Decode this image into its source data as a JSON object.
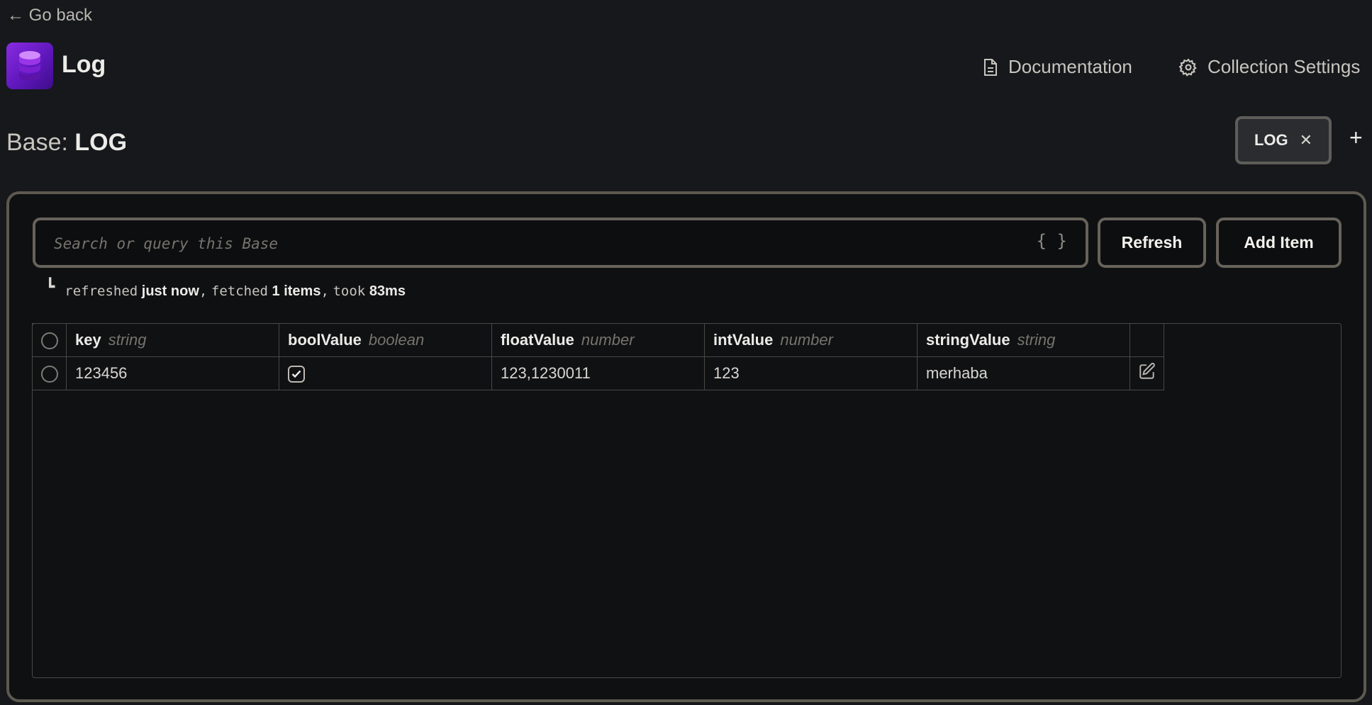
{
  "nav": {
    "back_label": "← Go back"
  },
  "header": {
    "title": "Log",
    "icon": "database-icon",
    "documentation_label": "Documentation",
    "settings_label": "Collection Settings"
  },
  "base": {
    "prefix": "Base:",
    "name": "LOG"
  },
  "tabs": [
    {
      "label": "LOG"
    }
  ],
  "search": {
    "placeholder": "Search or query this Base",
    "value": "",
    "braces": "{ }"
  },
  "buttons": {
    "refresh": "Refresh",
    "add_item": "Add Item"
  },
  "status": {
    "corner": "┗",
    "refreshed_text": "refreshed",
    "refreshed_value": "just now",
    "sep1": ",",
    "fetched_text": "fetched",
    "fetched_value": "1 items",
    "sep2": ",",
    "took_text": "took",
    "took_value": "83ms"
  },
  "table": {
    "columns": [
      {
        "name": "key",
        "type": "string"
      },
      {
        "name": "boolValue",
        "type": "boolean"
      },
      {
        "name": "floatValue",
        "type": "number"
      },
      {
        "name": "intValue",
        "type": "number"
      },
      {
        "name": "stringValue",
        "type": "string"
      }
    ],
    "rows": [
      {
        "key": "123456",
        "boolValue": true,
        "floatValue": "123,1230011",
        "intValue": "123",
        "stringValue": "merhaba"
      }
    ]
  },
  "colors": {
    "background": "#16181b",
    "panel_border": "#5d594f",
    "accent_purple": "#8a2be2"
  }
}
